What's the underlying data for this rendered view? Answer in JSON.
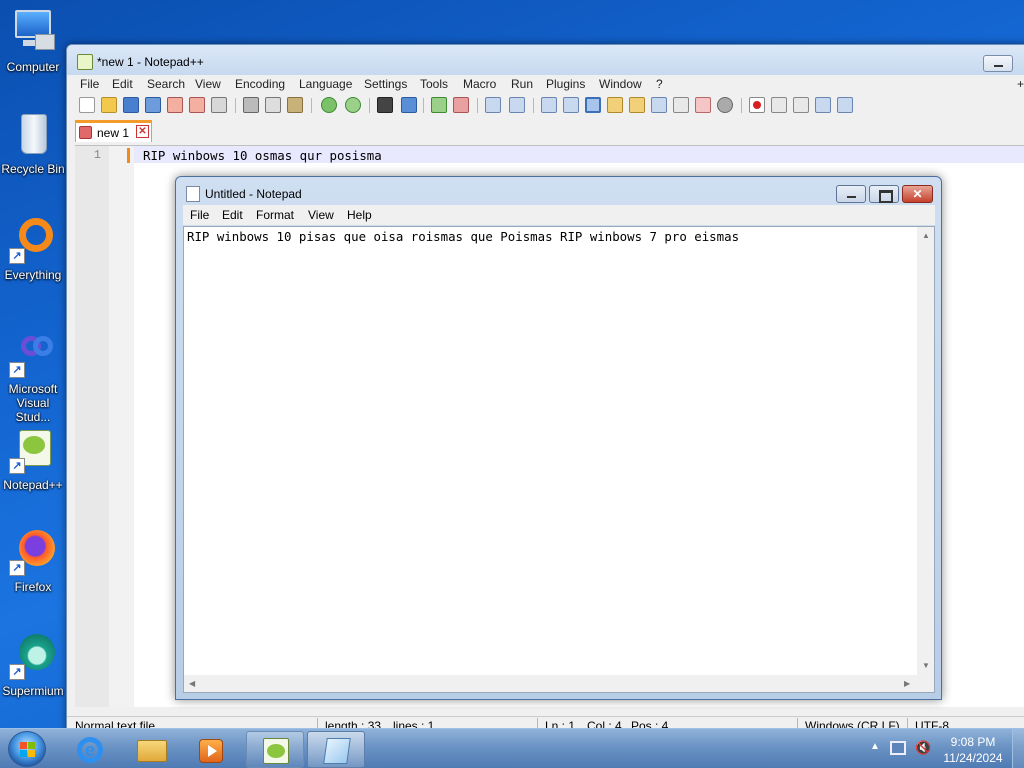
{
  "desktop": {
    "icons": [
      {
        "label": "Computer",
        "icon": "computer-icon"
      },
      {
        "label": "Recycle Bin",
        "icon": "recycle-bin-icon"
      },
      {
        "label": "Everything",
        "icon": "everything-icon"
      },
      {
        "label": "Microsoft Visual Stud...",
        "icon": "visual-studio-icon"
      },
      {
        "label": "Notepad++",
        "icon": "notepadpp-icon"
      },
      {
        "label": "Firefox",
        "icon": "firefox-icon"
      },
      {
        "label": "Supermium",
        "icon": "supermium-icon"
      }
    ]
  },
  "npp": {
    "title": "*new 1 - Notepad++",
    "menu": [
      "File",
      "Edit",
      "Search",
      "View",
      "Encoding",
      "Language",
      "Settings",
      "Tools",
      "Macro",
      "Run",
      "Plugins",
      "Window",
      "?"
    ],
    "menu_plus": "+",
    "tab_label": "new 1",
    "tab_close": "✕",
    "line_number": "1",
    "line_text": "RIP winbows 10 osmas qur posisma",
    "status": {
      "type": "Normal text file",
      "length": "length : 33",
      "lines": "lines : 1",
      "ln": "Ln : 1",
      "col": "Col : 4",
      "pos": "Pos : 4",
      "eol": "Windows (CR LF)",
      "encoding": "UTF-8"
    },
    "accent": "#f39a2a"
  },
  "notepad": {
    "title": "Untitled - Notepad",
    "menu": [
      "File",
      "Edit",
      "Format",
      "View",
      "Help"
    ],
    "text": "RIP winbows 10 pisas que oisa roismas que Poismas RIP winbows 7 pro eismas",
    "close_glyph": "✕"
  },
  "taskbar": {
    "clock_time": "9:08 PM",
    "clock_date": "11/24/2024",
    "items": [
      "start-orb-icon",
      "internet-explorer-icon",
      "file-explorer-icon",
      "media-player-icon",
      "notepadpp-taskbar-icon",
      "notepad-taskbar-icon"
    ]
  }
}
